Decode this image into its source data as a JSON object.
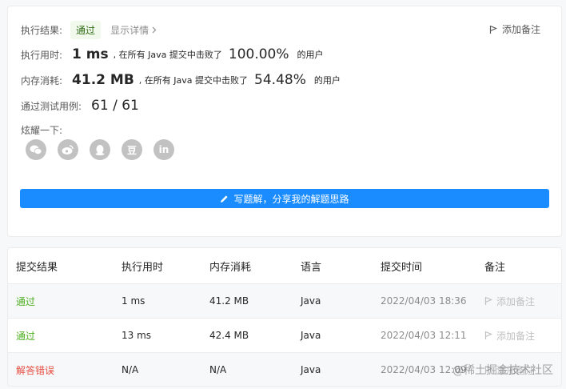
{
  "summary": {
    "result_label": "执行结果:",
    "result_value": "通过",
    "details_link": "显示详情",
    "add_note": "添加备注",
    "runtime_label": "执行用时:",
    "runtime_value": "1 ms",
    "runtime_mid": ", 在所有 Java 提交中击败了",
    "runtime_pct": "100.00%",
    "runtime_suffix": "的用户",
    "memory_label": "内存消耗:",
    "memory_value": "41.2 MB",
    "memory_mid": ", 在所有 Java 提交中击败了",
    "memory_pct": "54.48%",
    "memory_suffix": "的用户",
    "tests_label": "通过测试用例:",
    "tests_value": "61 / 61",
    "share_label": "炫耀一下:",
    "share_icons": [
      "wechat-icon",
      "weibo-icon",
      "qq-icon",
      "douban-icon",
      "linkedin-icon"
    ],
    "douban_glyph": "豆",
    "linkedin_glyph": "in",
    "write_solution_button": "写题解，分享我的解题思路"
  },
  "table": {
    "headers": [
      "提交结果",
      "执行用时",
      "内存消耗",
      "语言",
      "提交时间",
      "备注"
    ],
    "rows": [
      {
        "result": "通过",
        "runtime": "1 ms",
        "memory": "41.2 MB",
        "language": "Java",
        "time": "2022/04/03 18:36",
        "note": "添加备注"
      },
      {
        "result": "通过",
        "runtime": "13 ms",
        "memory": "42.4 MB",
        "language": "Java",
        "time": "2022/04/03 12:11",
        "note": "添加备注"
      },
      {
        "result": "解答错误",
        "runtime": "N/A",
        "memory": "N/A",
        "language": "Java",
        "time": "2022/04/03 12:09",
        "note": "添加备注"
      }
    ]
  },
  "watermark": "@稀土掘金技术社区",
  "colors": {
    "accent": "#1a8cff",
    "passed": "#4caf1f",
    "failed": "#e64d42"
  }
}
